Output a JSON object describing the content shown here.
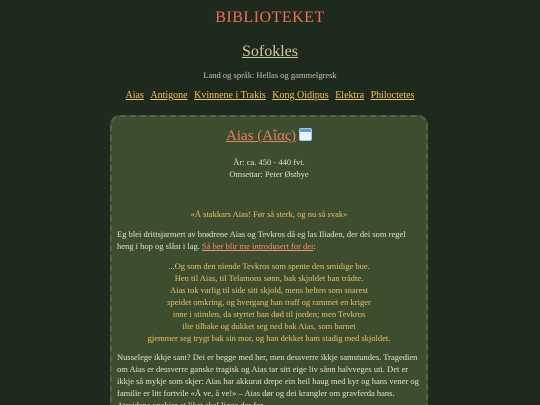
{
  "site": {
    "title": "BIBLIOTEKET"
  },
  "author": {
    "name": "Sofokles",
    "meta": "Land og språk: Hellas og gammelgresk"
  },
  "works_nav": [
    "Aias",
    "Antigone",
    "Kvinnene i Trakis",
    "Kong Oidipus",
    "Elektra",
    "Philoctetes"
  ],
  "work": {
    "title": "Aias (Αἴας)",
    "icon": "calendar-icon",
    "year": "År: ca. 450 - 440 fvt.",
    "translator": "Omsettar: Peter Østbye",
    "quote": "«Å stakkars Aias! Før så sterk, og nu så svak»",
    "intro_text": "Eg blei drittsjarmert av brødrene Aias og Tevkros då eg las Iliaden, der dei som regel heng i hop og slåst i lag. ",
    "intro_link": "Så her blir me introdusert for dei",
    "intro_end": ":",
    "verse": [
      "...Og som den niende Tevkros som spente den smidige bue.",
      "Hen til Aias, til Telamons sønn, bak skjoldet han trådte.",
      "Aias tok varlig til side sitt skjold, mens helten som snarest",
      "speidet omkring, og hvergang han traff og rammet en kriger",
      "inne i stimlen, da styrtet han død til jorden; men Tevkros",
      "ilte tilbake og dukket seg ned bak Aias, som barnet",
      "gjemmer seg trygt bak sin mor, og han dekket ham stadig med skjoldet."
    ],
    "paragraph2": "Nusselege ikkje sant? Dei er begge med her, men dessverre ikkje samstundes. Tragedien om Aias er dessverre ganske tragisk og Aias tar sitt eige liv sånn halvveges uti. Det er ikkje så mykje som skjer: Aias har akkurat drepe ein heil haug med kyr og hans vener og familie er litt fortvile «Å ve, å ve!» – Aias dør og dei krangler om gravferda hans. Atreidene ynskjer at liket skal ligge der for"
  },
  "colors": {
    "background": "#1f2a1f",
    "site_title": "#ee6f4f",
    "link": "#f1c25c",
    "card": "#3c4d30",
    "accent_link": "#ff8a70"
  }
}
